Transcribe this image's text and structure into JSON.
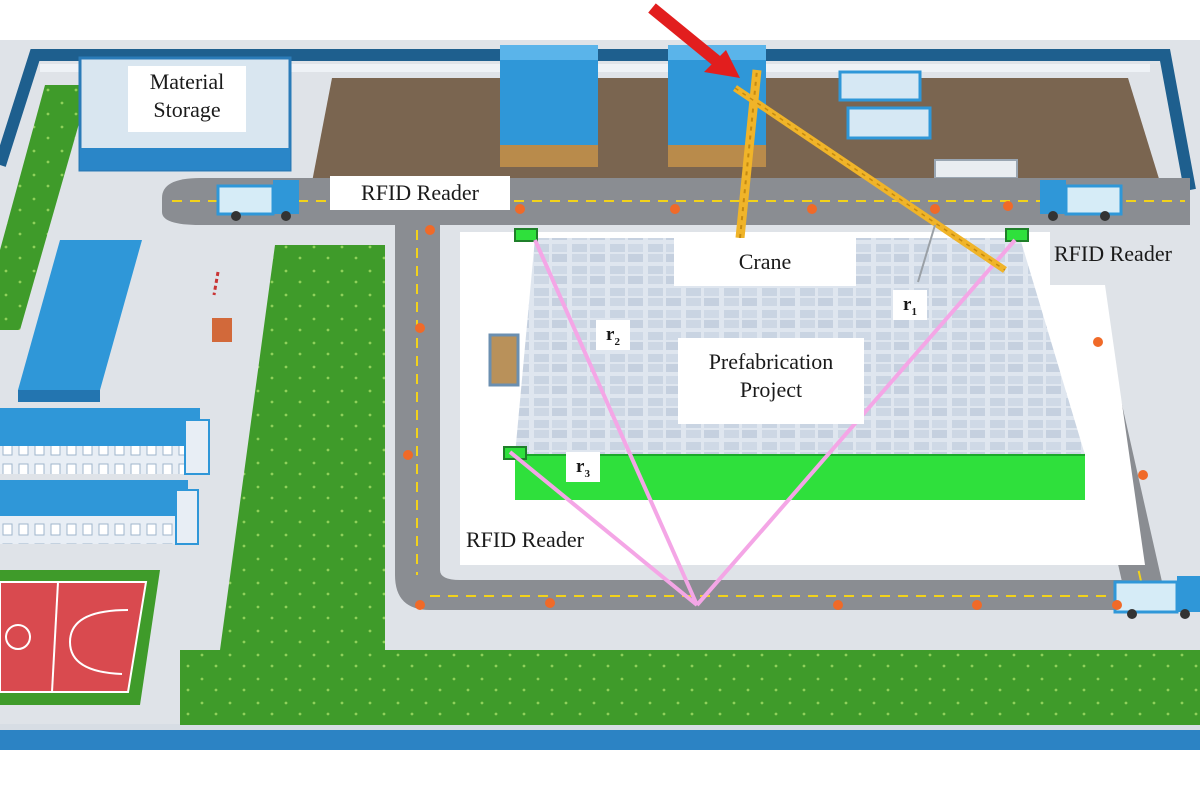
{
  "labels": {
    "material_storage_line1": "Material",
    "material_storage_line2": "Storage",
    "rfid_reader_top": "RFID Reader",
    "rfid_reader_right": "RFID Reader",
    "rfid_reader_bottom": "RFID Reader",
    "crane": "Crane",
    "project_line1": "Prefabrication",
    "project_line2": "Project"
  },
  "ranges": [
    {
      "letter": "r",
      "index": "1"
    },
    {
      "letter": "r",
      "index": "2"
    },
    {
      "letter": "r",
      "index": "3"
    }
  ],
  "colors": {
    "grass": "#3f9b2a",
    "road": "#8a8d92",
    "road_edge": "#5b5e63",
    "dash": "#f2d21a",
    "marker": "#f06a28",
    "fence": "#1e5f8e",
    "border_band": "#2c83c4",
    "building_blue": "#2f97d8",
    "crane": "#f0b429",
    "signal_line": "#f4a6e6",
    "green_side": "#2fe03c",
    "arrow": "#e21e1e",
    "court": "#d94a4f"
  }
}
